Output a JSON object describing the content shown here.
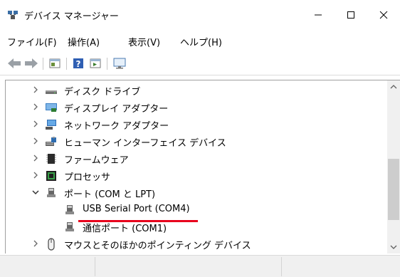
{
  "window": {
    "title": "デバイス マネージャー",
    "minimize_glyph": "—",
    "maximize_glyph": "☐",
    "close_glyph": "✕"
  },
  "menu": [
    {
      "label": "ファイル(F)"
    },
    {
      "label": "操作(A)"
    },
    {
      "label": "表示(V)"
    },
    {
      "label": "ヘルプ(H)"
    }
  ],
  "toolbar": {
    "icons": [
      "back-arrow-icon",
      "forward-arrow-icon",
      "properties-icon",
      "help-icon",
      "action-pane-icon",
      "monitor-icon"
    ]
  },
  "tree": {
    "items": [
      {
        "label": "ディスク ドライブ",
        "expanded": false,
        "icon": "disk-drive-icon"
      },
      {
        "label": "ディスプレイ アダプター",
        "expanded": false,
        "icon": "display-adapter-icon"
      },
      {
        "label": "ネットワーク アダプター",
        "expanded": false,
        "icon": "network-adapter-icon"
      },
      {
        "label": "ヒューマン インターフェイス デバイス",
        "expanded": false,
        "icon": "hid-icon"
      },
      {
        "label": "ファームウェア",
        "expanded": false,
        "icon": "firmware-icon"
      },
      {
        "label": "プロセッサ",
        "expanded": false,
        "icon": "processor-icon"
      },
      {
        "label": "ポート (COM と LPT)",
        "expanded": true,
        "icon": "port-icon"
      },
      {
        "label": "USB Serial Port (COM4)",
        "child": true,
        "highlighted": true,
        "icon": "port-icon"
      },
      {
        "label": "通信ポート (COM1)",
        "child": true,
        "icon": "port-icon"
      },
      {
        "label": "マウスとそのほかのポインティング デバイス",
        "expanded": false,
        "icon": "mouse-icon"
      }
    ],
    "highlight_color": "#e8001c"
  },
  "scrollbar": {
    "up_glyph": "^",
    "down_glyph": "v"
  }
}
